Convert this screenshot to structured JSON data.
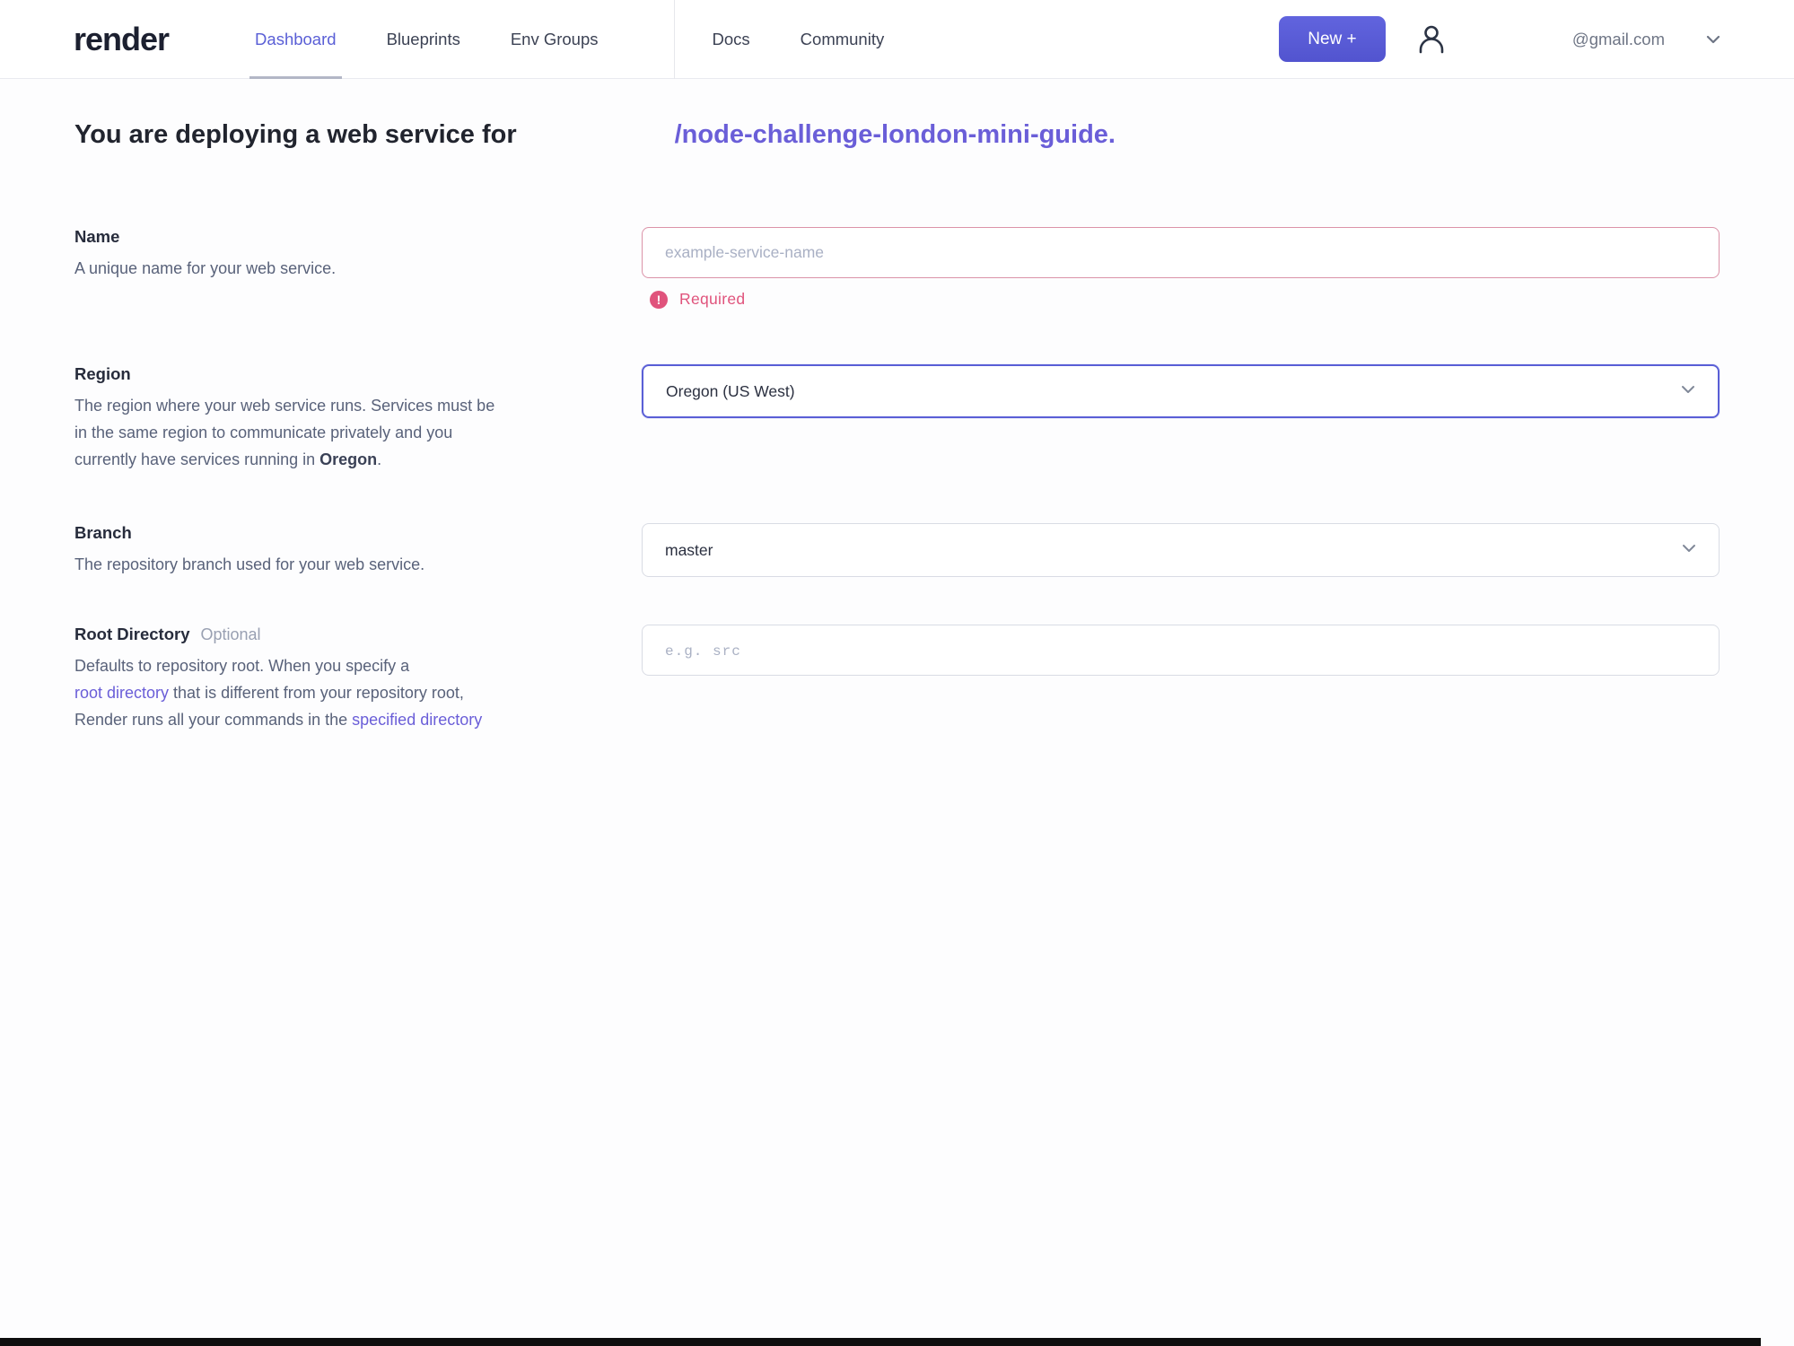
{
  "colors": {
    "accent": "#5a5fd6",
    "error": "#e0537c",
    "link": "#6a5ed8"
  },
  "brand": {
    "logo_text": "render"
  },
  "nav": {
    "items": [
      {
        "label": "Dashboard",
        "active": true
      },
      {
        "label": "Blueprints",
        "active": false
      },
      {
        "label": "Env Groups",
        "active": false
      },
      {
        "label": "Docs",
        "active": false
      },
      {
        "label": "Community",
        "active": false
      }
    ],
    "new_button_label": "New +",
    "account_email": "@gmail.com"
  },
  "heading": {
    "prefix": "You are deploying a web service for",
    "repo_link": "/node-challenge-london-mini-guide."
  },
  "form": {
    "name": {
      "label": "Name",
      "description": "A unique name for your web service.",
      "placeholder": "example-service-name",
      "error": "Required"
    },
    "region": {
      "label": "Region",
      "description_parts": [
        {
          "text": "The region where your web service runs. Services must be",
          "style": "normal",
          "break": true
        },
        {
          "text": "in the same region to communicate privately and you",
          "style": "normal",
          "break": true
        },
        {
          "text": "currently have services running in ",
          "style": "normal"
        },
        {
          "text": "Oregon",
          "style": "bold"
        },
        {
          "text": ".",
          "style": "normal"
        }
      ],
      "value": "Oregon (US West)"
    },
    "branch": {
      "label": "Branch",
      "description": "The repository branch used for your web service.",
      "value": "master"
    },
    "root_directory": {
      "label": "Root Directory",
      "optional_tag": "Optional",
      "description_parts": [
        {
          "text": "Defaults to repository root. When you specify a",
          "style": "normal",
          "break": true
        },
        {
          "text": "root directory",
          "style": "link"
        },
        {
          "text": " that is different from your repository root,",
          "style": "normal",
          "break": true
        },
        {
          "text": "Render runs all your commands in the ",
          "style": "normal"
        },
        {
          "text": "specified directory",
          "style": "link"
        }
      ],
      "placeholder": "e.g. src"
    }
  }
}
